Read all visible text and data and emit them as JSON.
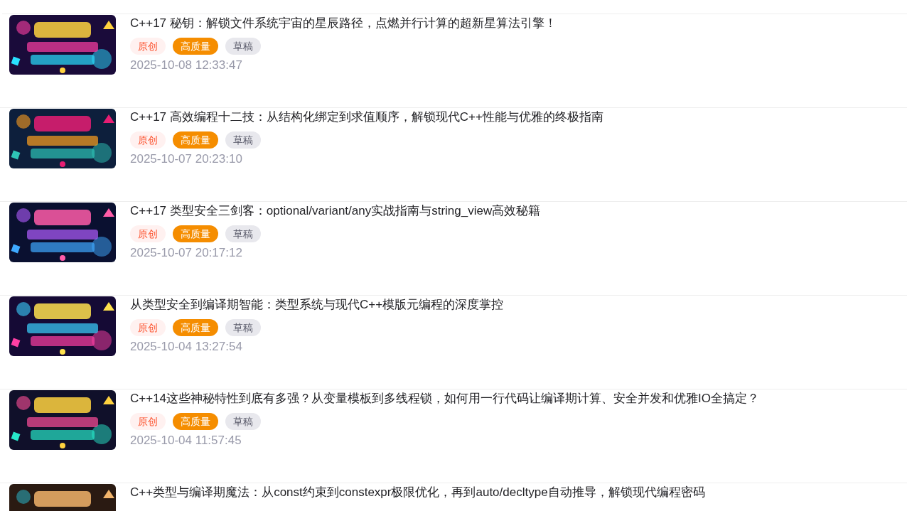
{
  "posts": [
    {
      "title": "C++17 秘钥：解锁文件系统宇宙的星辰路径，点燃并行计算的超新星算法引擎！",
      "tags": [
        {
          "kind": "original",
          "label": "原创"
        },
        {
          "kind": "quality",
          "label": "高质量"
        },
        {
          "kind": "draft",
          "label": "草稿"
        }
      ],
      "date": "2025-10-08 12:33:47"
    },
    {
      "title": "C++17 高效编程十二技：从结构化绑定到求值顺序，解锁现代C++性能与优雅的终极指南",
      "tags": [
        {
          "kind": "original",
          "label": "原创"
        },
        {
          "kind": "quality",
          "label": "高质量"
        },
        {
          "kind": "draft",
          "label": "草稿"
        }
      ],
      "date": "2025-10-07 20:23:10"
    },
    {
      "title": "C++17 类型安全三剑客：optional/variant/any实战指南与string_view高效秘籍",
      "tags": [
        {
          "kind": "original",
          "label": "原创"
        },
        {
          "kind": "quality",
          "label": "高质量"
        },
        {
          "kind": "draft",
          "label": "草稿"
        }
      ],
      "date": "2025-10-07 20:17:12"
    },
    {
      "title": "从类型安全到编译期智能：类型系统与现代C++模版元编程的深度掌控",
      "tags": [
        {
          "kind": "original",
          "label": "原创"
        },
        {
          "kind": "quality",
          "label": "高质量"
        },
        {
          "kind": "draft",
          "label": "草稿"
        }
      ],
      "date": "2025-10-04 13:27:54"
    },
    {
      "title": "C++14这些神秘特性到底有多强？从变量模板到多线程锁，如何用一行代码让编译期计算、安全并发和优雅IO全搞定？",
      "tags": [
        {
          "kind": "original",
          "label": "原创"
        },
        {
          "kind": "quality",
          "label": "高质量"
        },
        {
          "kind": "draft",
          "label": "草稿"
        }
      ],
      "date": "2025-10-04 11:57:45"
    },
    {
      "title": "C++类型与编译期魔法：从const约束到constexpr极限优化，再到auto/decltype自动推导，解锁现代编程密码"
    }
  ]
}
